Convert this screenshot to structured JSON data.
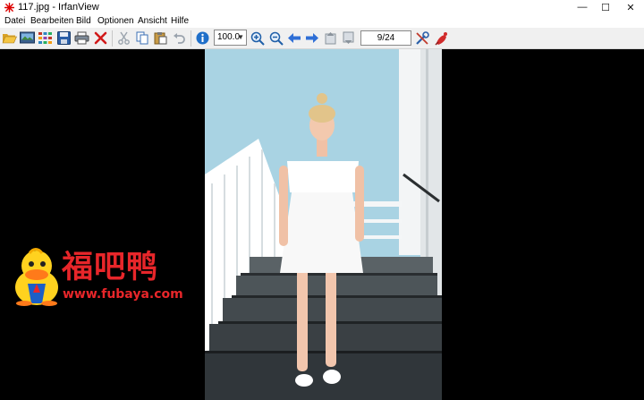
{
  "window": {
    "title": "117.jpg - IrfanView",
    "minimize_icon": "minimize-icon",
    "maximize_icon": "maximize-icon",
    "close_icon": "close-icon",
    "minimize_glyph": "—",
    "maximize_glyph": "☐",
    "close_glyph": "✕"
  },
  "menu": [
    "Datei",
    "Bearbeiten",
    "Bild",
    "Optionen",
    "Ansicht",
    "Hilfe"
  ],
  "toolbar": {
    "zoom_value": "100.0",
    "zoom_dropdown_icon": "chevron-down-icon",
    "page_indicator": "9/24",
    "icons": [
      "open-folder-icon",
      "slideshow-icon",
      "thumbnails-icon",
      "save-icon",
      "print-icon",
      "delete-icon",
      "cut-icon",
      "copy-icon",
      "paste-icon",
      "undo-icon",
      "info-icon",
      "zoom-in-icon",
      "zoom-out-icon",
      "previous-icon",
      "next-icon",
      "first-page-icon",
      "last-page-icon",
      "settings-icon",
      "about-icon"
    ]
  },
  "watermark": {
    "chinese_text": "福吧鸭",
    "url": "www.fubaya.com",
    "mascot_icon": "duck-mascot-icon",
    "color": "#e8262a"
  },
  "colors": {
    "toolbar_bg": "#f0f0f0",
    "viewer_bg": "#000000",
    "sky": "#a9d3e3",
    "accent_red": "#e8262a"
  }
}
